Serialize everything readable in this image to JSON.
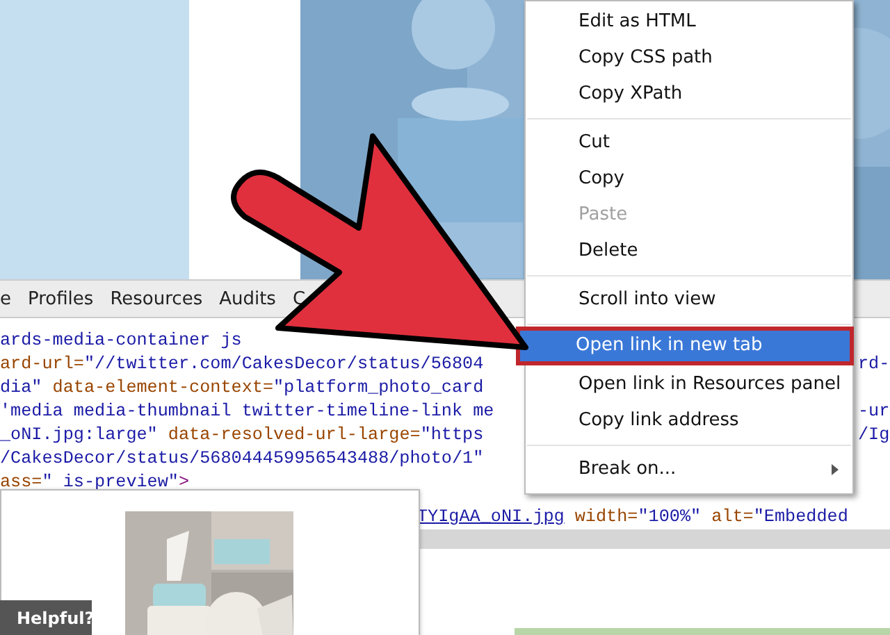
{
  "devtools": {
    "tabs": [
      "e",
      "Profiles",
      "Resources",
      "Audits",
      "C"
    ],
    "code_lines": [
      {
        "segments": [
          {
            "kind": "value",
            "text": "ards-media-container js"
          }
        ]
      },
      {
        "segments": [
          {
            "kind": "attr",
            "text": "ard-url="
          },
          {
            "kind": "value",
            "text": "\"//twitter.com/CakesDecor/status/56804"
          }
        ],
        "tail": "rd-"
      },
      {
        "segments": [
          {
            "kind": "value",
            "text": "dia\""
          },
          {
            "kind": "attr",
            "text": " data-element-context="
          },
          {
            "kind": "value",
            "text": "\"platform_photo_card"
          }
        ]
      },
      {
        "segments": [
          {
            "kind": "value",
            "text": "'media media-thumbnail twitter-timeline-link me"
          }
        ],
        "tail": "-ur"
      },
      {
        "segments": [
          {
            "kind": "value",
            "text": "_oNI.jpg:large\""
          },
          {
            "kind": "attr",
            "text": " data-resolved-url-large="
          },
          {
            "kind": "value",
            "text": "\"https"
          }
        ],
        "tail": "/Ig"
      },
      {
        "segments": [
          {
            "kind": "value",
            "text": "/CakesDecor/status/568044459956543488/photo/1\""
          }
        ]
      },
      {
        "segments": [
          {
            "kind": "attr",
            "text": "ass="
          },
          {
            "kind": "value",
            "text": "\" is-preview\""
          },
          {
            "kind": "tag",
            "text": ">"
          }
        ]
      }
    ],
    "preview_line": {
      "segments": [
        {
          "kind": "link",
          "text": "TYIgAA_oNI.jpg"
        },
        {
          "kind": "attr",
          "text": " width="
        },
        {
          "kind": "value",
          "text": "\"100%\""
        },
        {
          "kind": "attr",
          "text": " alt="
        },
        {
          "kind": "value",
          "text": "\"Embedded"
        }
      ]
    }
  },
  "context_menu": [
    {
      "kind": "item",
      "label": "Edit as HTML",
      "disabled": false,
      "selected": false
    },
    {
      "kind": "item",
      "label": "Copy CSS path",
      "disabled": false,
      "selected": false
    },
    {
      "kind": "item",
      "label": "Copy XPath",
      "disabled": false,
      "selected": false
    },
    {
      "kind": "separator"
    },
    {
      "kind": "item",
      "label": "Cut",
      "disabled": false,
      "selected": false
    },
    {
      "kind": "item",
      "label": "Copy",
      "disabled": false,
      "selected": false
    },
    {
      "kind": "item",
      "label": "Paste",
      "disabled": true,
      "selected": false
    },
    {
      "kind": "item",
      "label": "Delete",
      "disabled": false,
      "selected": false
    },
    {
      "kind": "separator"
    },
    {
      "kind": "item",
      "label": "Scroll into view",
      "disabled": false,
      "selected": false
    },
    {
      "kind": "separator"
    },
    {
      "kind": "item",
      "label": "Open link in new tab",
      "disabled": false,
      "selected": true
    },
    {
      "kind": "item",
      "label": "Open link in Resources panel",
      "disabled": false,
      "selected": false
    },
    {
      "kind": "item",
      "label": "Copy link address",
      "disabled": false,
      "selected": false
    },
    {
      "kind": "separator"
    },
    {
      "kind": "submenu",
      "label": "Break on...",
      "disabled": false,
      "selected": false
    }
  ],
  "helpful_badge": {
    "label": "Helpful?"
  }
}
